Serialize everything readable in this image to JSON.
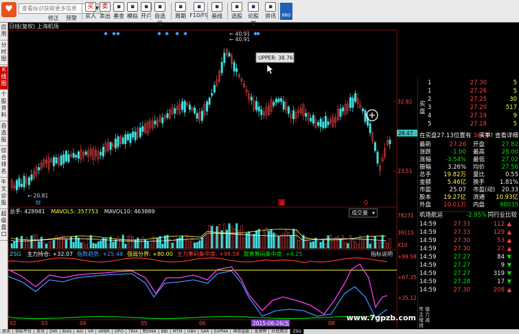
{
  "toolbar": {
    "search_placeholder": "查看标识获取更多信息",
    "mini_links": [
      "修正",
      "预警"
    ],
    "buttons": [
      {
        "label": "买入",
        "icon": "buy-icon"
      },
      {
        "label": "卖出",
        "icon": "sell-icon"
      },
      {
        "label": "基金",
        "icon": "fund-icon"
      },
      {
        "label": "模拟",
        "icon": "simulate-icon"
      },
      {
        "label": "开户",
        "icon": "open-account-icon"
      },
      {
        "label": "自选股",
        "icon": "watchlist-icon"
      },
      {
        "label": "周期",
        "icon": "period-icon"
      },
      {
        "label": "F10/F9",
        "icon": "f10-icon"
      },
      {
        "label": "画线",
        "icon": "draw-line-icon"
      },
      {
        "label": "选股",
        "icon": "stock-picker-icon"
      },
      {
        "label": "论股堂",
        "icon": "forum-icon"
      },
      {
        "label": "资讯",
        "icon": "news-icon"
      }
    ],
    "bbd": "BBD"
  },
  "sidebar": [
    "应用",
    "分时图",
    "K线图",
    "个股资料",
    "自选股",
    "综合排名",
    "牛叉诊股",
    "超级盘口"
  ],
  "chart": {
    "header": "日线(复权)   上海机场",
    "tooltip": "UPPER: 38.76",
    "high_marks": [
      "40.91",
      "40.91"
    ],
    "low_mark": "20.81",
    "event_letters": [
      "财",
      "送",
      "Q"
    ],
    "price_ticks": [
      "32.82",
      "28.47",
      "23.51"
    ],
    "current_price_tag": "28.47"
  },
  "volume": {
    "label": "总手: 428981",
    "ma5": "MAVOL5: 357753",
    "ma10": "MAVOL10: 463889",
    "dropdown": "成交量",
    "ticks": [
      "78231",
      "39115",
      "X10"
    ]
  },
  "zsg": {
    "name": "ZSG",
    "items": [
      {
        "label": "主力持仓: +32.07",
        "color": "#ffffff"
      },
      {
        "label": "指数趋势: +25.48",
        "color": "#40a0ff"
      },
      {
        "label": "强弱分界: +80.00",
        "color": "#ffff40"
      },
      {
        "label": "主力筹码集中度: +99.58",
        "color": "#ff4040"
      },
      {
        "label": "散筹筹码集中度: +4.25",
        "color": "#00e000"
      }
    ],
    "help": "指标说明",
    "ticks": [
      "+99.58",
      "+67.35",
      "+35.12"
    ]
  },
  "xaxis": [
    "02",
    "03",
    "04",
    "05",
    "06",
    "07",
    "08"
  ],
  "date_tag": "2015-06-26/五",
  "panel": {
    "name": "机场航运",
    "change": "-2.95%",
    "peer": "同行业比较",
    "bid_label": "买盘",
    "asks": [
      {
        "level": "1",
        "price": "27.30",
        "vol": "5"
      },
      {
        "level": "1",
        "price": "27.26",
        "vol": "5"
      },
      {
        "level": "2",
        "price": "27.25",
        "vol": "30"
      },
      {
        "level": "3",
        "price": "27.20",
        "vol": "517"
      },
      {
        "level": "4",
        "price": "27.19",
        "vol": "9"
      },
      {
        "level": "5",
        "price": "27.18",
        "vol": "5"
      }
    ],
    "prompt": {
      "left": "在买盘27.13位置有",
      "mid": "344手",
      "right": "买单! 查看详细"
    },
    "quote_rows": [
      {
        "l": "最新",
        "lv": "27.26",
        "m": "开盘",
        "mv": "27.82",
        "lc": "red",
        "mc": "green"
      },
      {
        "l": "涨跌",
        "lv": "-1.00",
        "m": "最高",
        "mv": "28.00",
        "lc": "green",
        "mc": "green"
      },
      {
        "l": "涨幅",
        "lv": "-3.54%",
        "m": "最低",
        "mv": "27.02",
        "lc": "green",
        "mc": "green"
      },
      {
        "l": "振幅",
        "lv": "3.26%",
        "m": "均价",
        "mv": "27.56",
        "lc": "white",
        "mc": "green"
      },
      {
        "l": "总手",
        "lv": "19.82万",
        "m": "量比",
        "mv": "0.55",
        "lc": "yellow",
        "mc": "white"
      },
      {
        "l": "金额",
        "lv": "5.46亿",
        "m": "换手",
        "mv": "1.81%",
        "lc": "yellow",
        "mc": "white"
      },
      {
        "l": "市盈",
        "lv": "25.07",
        "m": "市盈(动)",
        "mv": "20.33",
        "lc": "white",
        "mc": "white"
      },
      {
        "l": "股本",
        "lv": "19.27亿",
        "m": "流通",
        "mv": "10.93亿",
        "lc": "yellow",
        "mc": "yellow"
      },
      {
        "l": "外盘",
        "lv": "10.01万",
        "m": "内盘",
        "mv": "98035",
        "lc": "red",
        "mc": "green"
      }
    ],
    "ticks": [
      {
        "t": "14:59",
        "p": "27.33",
        "v": "112",
        "d": "up"
      },
      {
        "t": "14:59",
        "p": "27.33",
        "v": "129",
        "d": "up"
      },
      {
        "t": "14:59",
        "p": "27.30",
        "v": "53",
        "d": "up"
      },
      {
        "t": "14:59",
        "p": "27.30",
        "v": "27",
        "d": "up"
      },
      {
        "t": "14:59",
        "p": "27.27",
        "v": "84",
        "d": "dn"
      },
      {
        "t": "14:59",
        "p": "27.27",
        "v": "9",
        "d": "dn"
      },
      {
        "t": "14:59",
        "p": "27.27",
        "v": "319",
        "d": "dn"
      },
      {
        "t": "14:59",
        "p": "27.28",
        "v": "17",
        "d": "dn"
      },
      {
        "t": "14:59",
        "p": "27.30",
        "v": "208",
        "d": "up"
      }
    ],
    "side_tabs": [
      "买",
      "盘"
    ],
    "bottom_tabs": [
      "市",
      "值",
      "主",
      "力",
      "增",
      "减",
      "持"
    ]
  },
  "watermark": "www.7gpzb.com",
  "tabs": [
    "资讯",
    "指标平台",
    "资讯",
    "DMI",
    "BIAS",
    "ASI",
    "VR",
    "ARBR",
    "DPO",
    "TRIX",
    "新DMA",
    "BBI",
    "MTM",
    "OBV",
    "SAR",
    "EXPMA",
    "神奇选股",
    "龙虎榜",
    "抄底精灵",
    "ZSG"
  ]
}
